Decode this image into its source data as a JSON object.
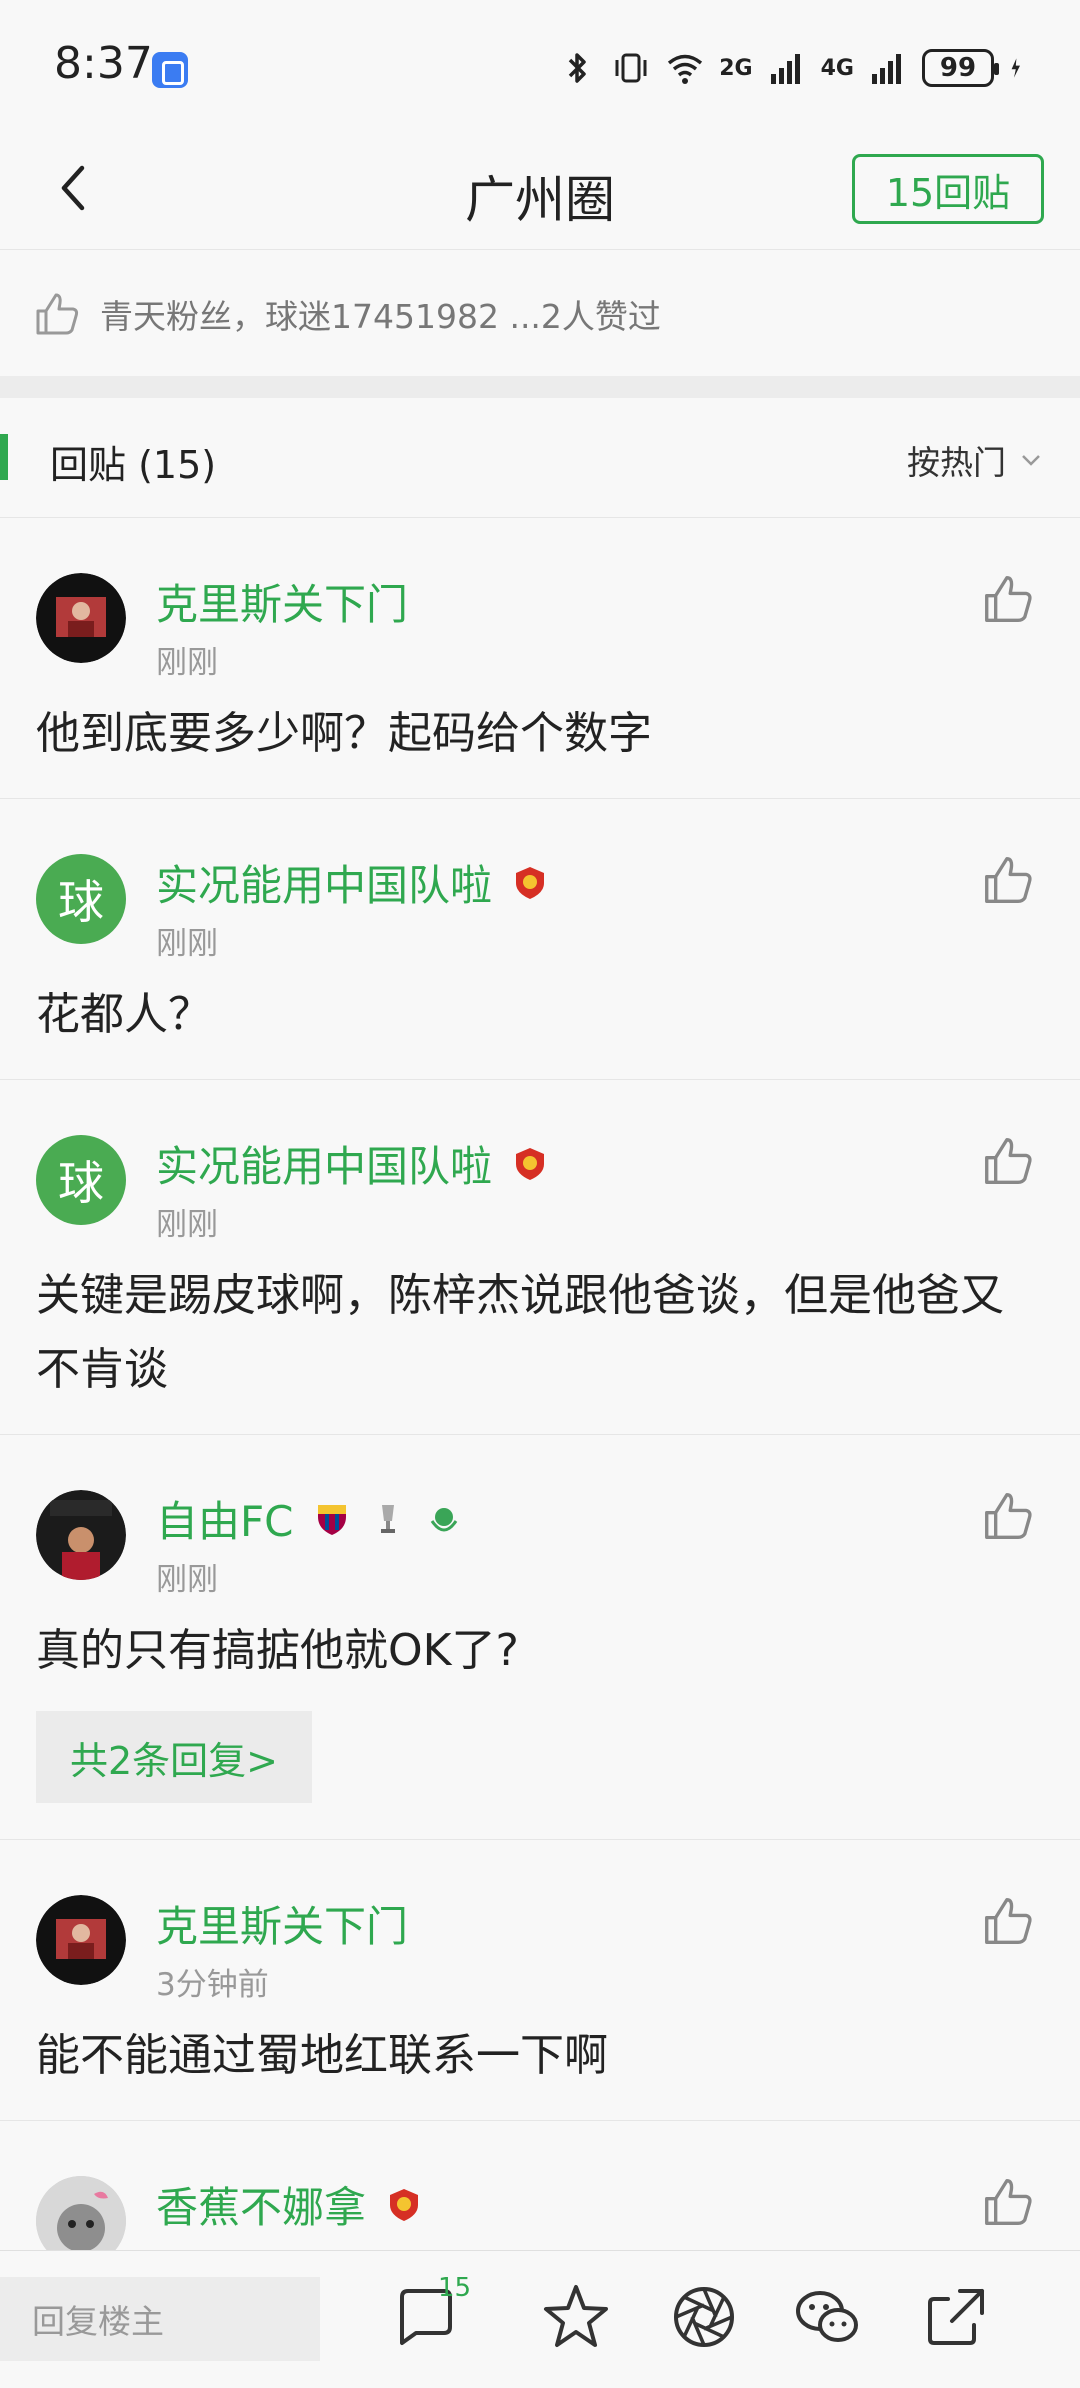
{
  "status_bar": {
    "time": "8:37",
    "net1": "2G",
    "net2": "4G",
    "battery": "99"
  },
  "nav": {
    "title": "广州圈",
    "reply_button": "15回贴"
  },
  "likes": {
    "text": "青天粉丝，球迷17451982 ...2人赞过"
  },
  "replies_header": {
    "title": "回贴 (15)",
    "sort": "按热门"
  },
  "posts": [
    {
      "user": "克里斯关下门",
      "time": "刚刚",
      "text": "他到底要多少啊？起码给个数字"
    },
    {
      "user": "实况能用中国队啦",
      "avatar_char": "球",
      "time": "刚刚",
      "text": "花都人？"
    },
    {
      "user": "实况能用中国队啦",
      "avatar_char": "球",
      "time": "刚刚",
      "text": "关键是踢皮球啊，陈梓杰说跟他爸谈，但是他爸又不肯谈"
    },
    {
      "user": "自由FC",
      "time": "刚刚",
      "text": "真的只有搞掂他就OK了?",
      "more": "共2条回复>"
    },
    {
      "user": "克里斯关下门",
      "time": "3分钟前",
      "text": "能不能通过蜀地红联系一下啊"
    },
    {
      "user": "香蕉不娜拿",
      "time": ""
    }
  ],
  "bottom_bar": {
    "reply_placeholder": "回复楼主",
    "comment_count": "15"
  },
  "colors": {
    "accent": "#2fa84f",
    "text": "#222222",
    "muted": "#999999"
  }
}
